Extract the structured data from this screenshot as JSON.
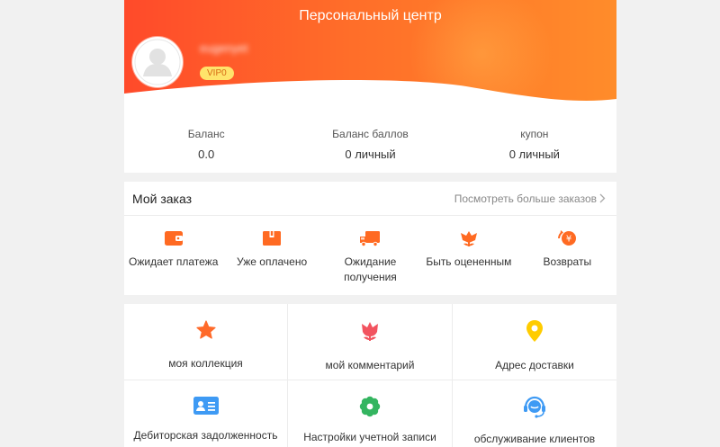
{
  "header": {
    "title": "Персональный центр",
    "username": "eugenyet",
    "vip_label": "VIP0"
  },
  "balance": [
    {
      "label": "Баланс",
      "value": "0.0"
    },
    {
      "label": "Баланс баллов",
      "value": "0 личный"
    },
    {
      "label": "купон",
      "value": "0 личный"
    }
  ],
  "orders": {
    "title": "Мой заказ",
    "more_label": "Посмотреть больше заказов",
    "items": [
      {
        "label": "Ожидает платежа",
        "icon": "wallet-icon"
      },
      {
        "label": "Уже оплачено",
        "icon": "package-icon"
      },
      {
        "label": "Ожидание получения",
        "icon": "delivery-truck-icon"
      },
      {
        "label": "Быть оцененным",
        "icon": "flower-icon"
      },
      {
        "label": "Возвраты",
        "icon": "refund-icon"
      }
    ]
  },
  "grid": [
    {
      "label": "моя коллекция",
      "icon": "star-icon"
    },
    {
      "label": "мой комментарий",
      "icon": "tulip-icon"
    },
    {
      "label": "Адрес доставки",
      "icon": "location-pin-icon"
    },
    {
      "label": "Дебиторская задолженность",
      "icon": "id-card-icon"
    },
    {
      "label": "Настройки учетной записи",
      "icon": "settings-flower-icon"
    },
    {
      "label": "обслуживание клиентов",
      "icon": "headset-icon"
    }
  ],
  "colors": {
    "accent": "#ff6a2a",
    "header_start": "#ff4a2a",
    "header_end": "#ff8c2a",
    "vip_bg": "#ffe36b",
    "location_yellow": "#ffcc00",
    "id_card_blue": "#3e9af4",
    "settings_green": "#34b560"
  }
}
